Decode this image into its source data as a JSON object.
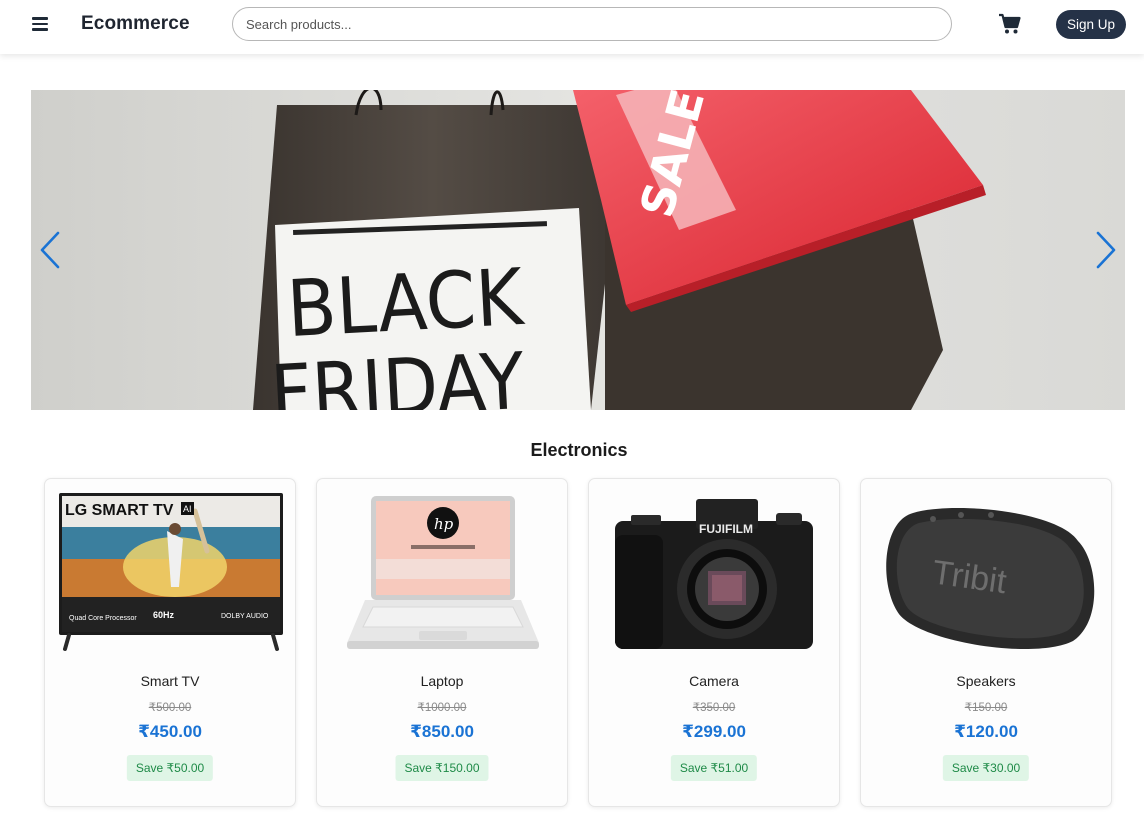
{
  "header": {
    "brand": "Ecommerce",
    "search_placeholder": "Search products...",
    "signup_label": "Sign Up"
  },
  "banner": {
    "bag_text_line1": "BLACK",
    "bag_text_line2": "FRIDAY",
    "sale_text": "SALE"
  },
  "section": {
    "title": "Electronics"
  },
  "products": [
    {
      "name": "Smart TV",
      "old_price": "₹500.00",
      "price": "₹450.00",
      "save": "Save ₹50.00",
      "image_text": {
        "brand": "LG SMART TV",
        "badge": "AI",
        "f1": "Quad Core Processor",
        "f2": "60Hz",
        "f3": "DOLBY AUDIO"
      }
    },
    {
      "name": "Laptop",
      "old_price": "₹1000.00",
      "price": "₹850.00",
      "save": "Save ₹150.00",
      "image_text": {
        "logo": "hp"
      }
    },
    {
      "name": "Camera",
      "old_price": "₹350.00",
      "price": "₹299.00",
      "save": "Save ₹51.00",
      "image_text": {
        "brand": "FUJIFILM"
      }
    },
    {
      "name": "Speakers",
      "old_price": "₹150.00",
      "price": "₹120.00",
      "save": "Save ₹30.00",
      "image_text": {
        "brand": "Tribit"
      }
    }
  ],
  "colors": {
    "accent": "#1a73d4",
    "button": "#253247",
    "save_bg": "#dff5e6",
    "save_text": "#1e8a47",
    "sale_red": "#e8343f"
  },
  "icons": {
    "menu": "hamburger-icon",
    "cart": "shopping-cart-icon",
    "prev": "chevron-left-icon",
    "next": "chevron-right-icon"
  }
}
